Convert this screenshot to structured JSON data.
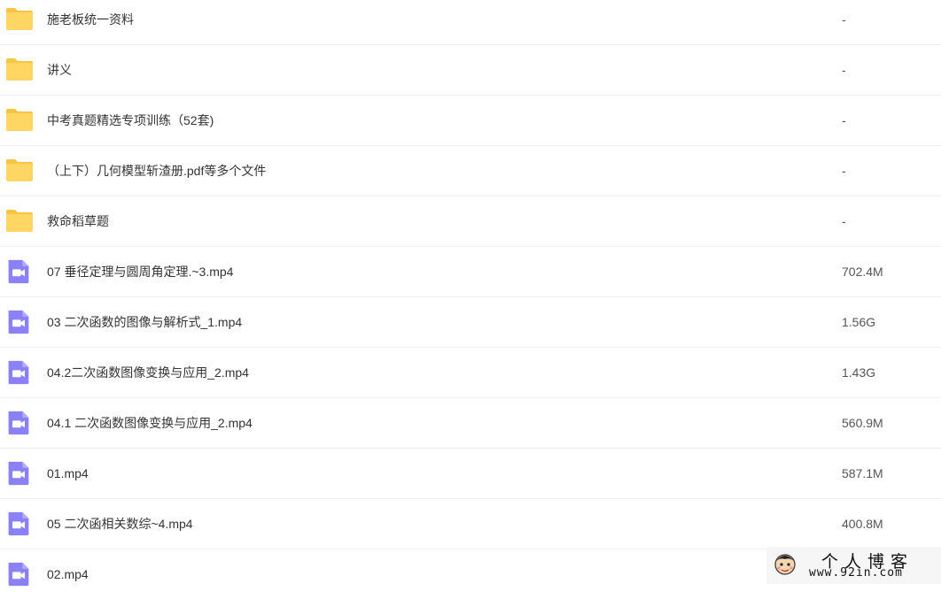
{
  "files": [
    {
      "type": "folder",
      "name": "施老板统一资料",
      "size": "-"
    },
    {
      "type": "folder",
      "name": "讲义",
      "size": "-"
    },
    {
      "type": "folder",
      "name": "中考真题精选专项训练（52套)",
      "size": "-"
    },
    {
      "type": "folder",
      "name": "（上下）几何模型斩渣册.pdf等多个文件",
      "size": "-"
    },
    {
      "type": "folder",
      "name": "救命稻草题",
      "size": "-"
    },
    {
      "type": "video",
      "name": "07 垂径定理与圆周角定理.~3.mp4",
      "size": "702.4M"
    },
    {
      "type": "video",
      "name": "03 二次函数的图像与解析式_1.mp4",
      "size": "1.56G"
    },
    {
      "type": "video",
      "name": "04.2二次函数图像变换与应用_2.mp4",
      "size": "1.43G"
    },
    {
      "type": "video",
      "name": "04.1 二次函数图像变换与应用_2.mp4",
      "size": "560.9M"
    },
    {
      "type": "video",
      "name": "01.mp4",
      "size": "587.1M"
    },
    {
      "type": "video",
      "name": "05 二次函相关数综~4.mp4",
      "size": "400.8M"
    },
    {
      "type": "video",
      "name": "02.mp4",
      "size": ""
    }
  ],
  "icons": {
    "folder": "folder-icon",
    "video": "video-file-icon"
  },
  "colors": {
    "folder": "#ffd563",
    "folder_tab": "#f7c544",
    "video": "#8b80f5",
    "divider": "#efeff1"
  },
  "watermark": {
    "title": "个人博客",
    "url": "www.92in.com"
  }
}
